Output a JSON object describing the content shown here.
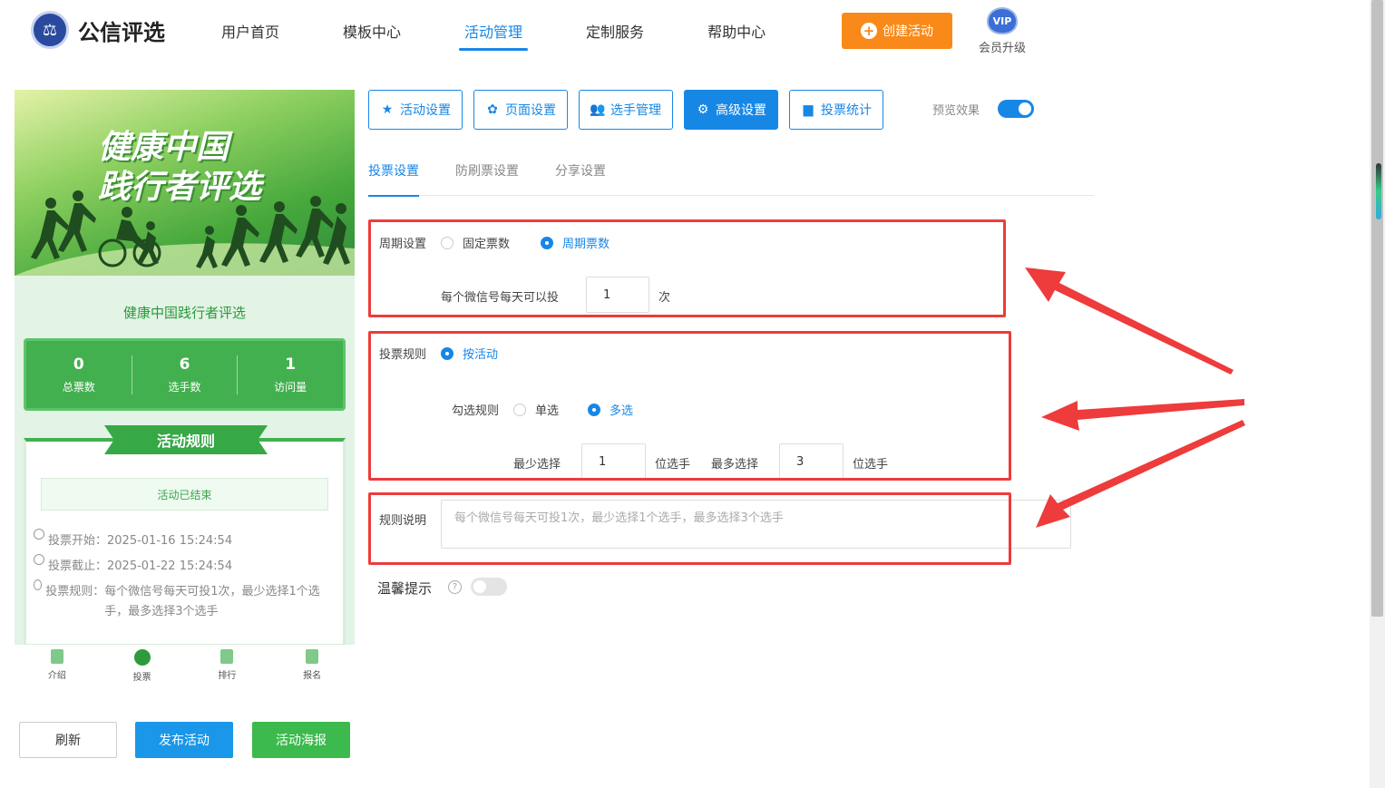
{
  "header": {
    "brand": "公信评选",
    "nav": [
      {
        "label": "用户首页",
        "active": false
      },
      {
        "label": "模板中心",
        "active": false
      },
      {
        "label": "活动管理",
        "active": true
      },
      {
        "label": "定制服务",
        "active": false
      },
      {
        "label": "帮助中心",
        "active": false
      }
    ],
    "create_button": "创建活动",
    "vip_badge": "VIP",
    "vip_label": "会员升级"
  },
  "preview": {
    "banner_line1": "健康中国",
    "banner_line2": "践行者评选",
    "activity_name": "健康中国践行者评选",
    "stats": [
      {
        "value": "0",
        "label": "总票数"
      },
      {
        "value": "6",
        "label": "选手数"
      },
      {
        "value": "1",
        "label": "访问量"
      }
    ],
    "rules_title": "活动规则",
    "ended_text": "活动已结束",
    "vote_start_key": "投票开始：",
    "vote_start_value": "2025-01-16 15:24:54",
    "vote_end_key": "投票截止：",
    "vote_end_value": "2025-01-22 15:24:54",
    "vote_rule_key": "投票规则：",
    "vote_rule_value": "每个微信号每天可投1次，最少选择1个选手，最多选择3个选手",
    "bottom_tabs": [
      {
        "label": "介绍",
        "icon": "intro-icon"
      },
      {
        "label": "投票",
        "icon": "vote-icon"
      },
      {
        "label": "排行",
        "icon": "rank-medal-icon"
      },
      {
        "label": "报名",
        "icon": "signup-icon"
      }
    ]
  },
  "actions": {
    "refresh": "刷新",
    "publish": "发布活动",
    "poster": "活动海报"
  },
  "config_tabs": [
    {
      "label": "活动设置",
      "icon": "star-icon",
      "active": false
    },
    {
      "label": "页面设置",
      "icon": "gear-icon",
      "active": false
    },
    {
      "label": "选手管理",
      "icon": "users-icon",
      "active": false
    },
    {
      "label": "高级设置",
      "icon": "settings-list-icon",
      "active": true
    },
    {
      "label": "投票统计",
      "icon": "bar-chart-icon",
      "active": false
    }
  ],
  "preview_toggle": {
    "label": "预览效果",
    "on": true
  },
  "sub_tabs": [
    {
      "label": "投票设置",
      "active": true
    },
    {
      "label": "防刷票设置",
      "active": false
    },
    {
      "label": "分享设置",
      "active": false
    }
  ],
  "form": {
    "cycle_label": "周期设置",
    "cycle_option_fixed": "固定票数",
    "cycle_option_periodic": "周期票数",
    "daily_label": "每个微信号每天可以投",
    "daily_value": "1",
    "daily_unit": "次",
    "rule_label": "投票规则",
    "rule_option": "按活动",
    "check_label": "勾选规则",
    "check_single": "单选",
    "check_multi": "多选",
    "min_label": "最少选择",
    "min_value": "1",
    "min_unit": "位选手",
    "max_label": "最多选择",
    "max_value": "3",
    "max_unit": "位选手",
    "desc_label": "规则说明",
    "desc_placeholder": "每个微信号每天可投1次，最少选择1个选手，最多选择3个选手",
    "tip_label": "温馨提示",
    "tip_help": "?",
    "tip_on": false
  },
  "colors": {
    "primary": "#1787e6",
    "orange": "#f98a1a",
    "green": "#3cba4d",
    "annotation_red": "#ee3b3b"
  }
}
